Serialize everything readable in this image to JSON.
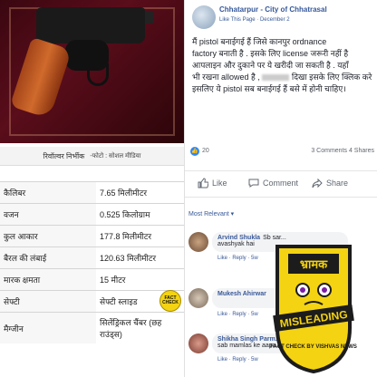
{
  "left_panel": {
    "caption": {
      "title": "रिवॉल्वर निर्भीक",
      "source": "-फोटो : सोशल मीडिया"
    },
    "specs": [
      {
        "key": "कैलिबर",
        "value": "7.65 मिलीमीटर"
      },
      {
        "key": "वजन",
        "value": "0.525 किलोग्राम"
      },
      {
        "key": "कुल आकार",
        "value": "177.8 मिलीमीटर"
      },
      {
        "key": "बैरल की लंबाई",
        "value": "120.63 मिलीमीटर"
      },
      {
        "key": "मारक क्षमता",
        "value": "15 मीटर"
      },
      {
        "key": "सेफ्टी",
        "value": "सेफ्टी स्लाइड"
      },
      {
        "key": "मैग्जीन",
        "value": "सिलेंड्रिकल चैंबर (छह राउंड्स)"
      }
    ],
    "small_sticker": "FACT CHECK"
  },
  "post": {
    "page_name": "Chhatarpur - City of Chhatrasal",
    "like_page": "Like This Page",
    "date": "December 2",
    "body_lines": [
      "मैं pistol बनाईगई हैं जिसे कानपुर ordnance",
      "factory बनाती है . इसके लिए license जरूरी नहीं है",
      "आपलाइन और दुकाने पर ये खरीदी जा सकती है . यहाँ",
      "भी रखना allowed है ,",
      "दिखा इसके लिए क्लिक करे",
      "इसलिए ये pistol सब बनाईगई हैं बसे में होनी चाहिए।"
    ],
    "likes": "20",
    "comments_shares": "3 Comments  4 Shares",
    "actions": {
      "like": "Like",
      "comment": "Comment",
      "share": "Share"
    },
    "most_relevant": "Most Relevant ▾",
    "comments": [
      {
        "name": "Arvind Shukla",
        "text": "Sb sar...",
        "text2": "avashyak hai",
        "links": "Like · Reply · 5w"
      },
      {
        "name": "Mukesh Ahirwar",
        "text": "",
        "text2": "",
        "links": "Like · Reply · 5w"
      },
      {
        "name": "Shikha Singh Parm...",
        "text": "",
        "text2": "sab mamlas ke aapa...",
        "links": "Like · Reply · 5w"
      }
    ]
  },
  "badge": {
    "top_word": "भ्रामक",
    "label": "MISLEADING",
    "footer": "FACT CHECK BY VISHVAS NEWS",
    "colors": {
      "yellow": "#f4d312",
      "dark": "#1c1c1c",
      "accent": "#7a1fa2"
    }
  }
}
